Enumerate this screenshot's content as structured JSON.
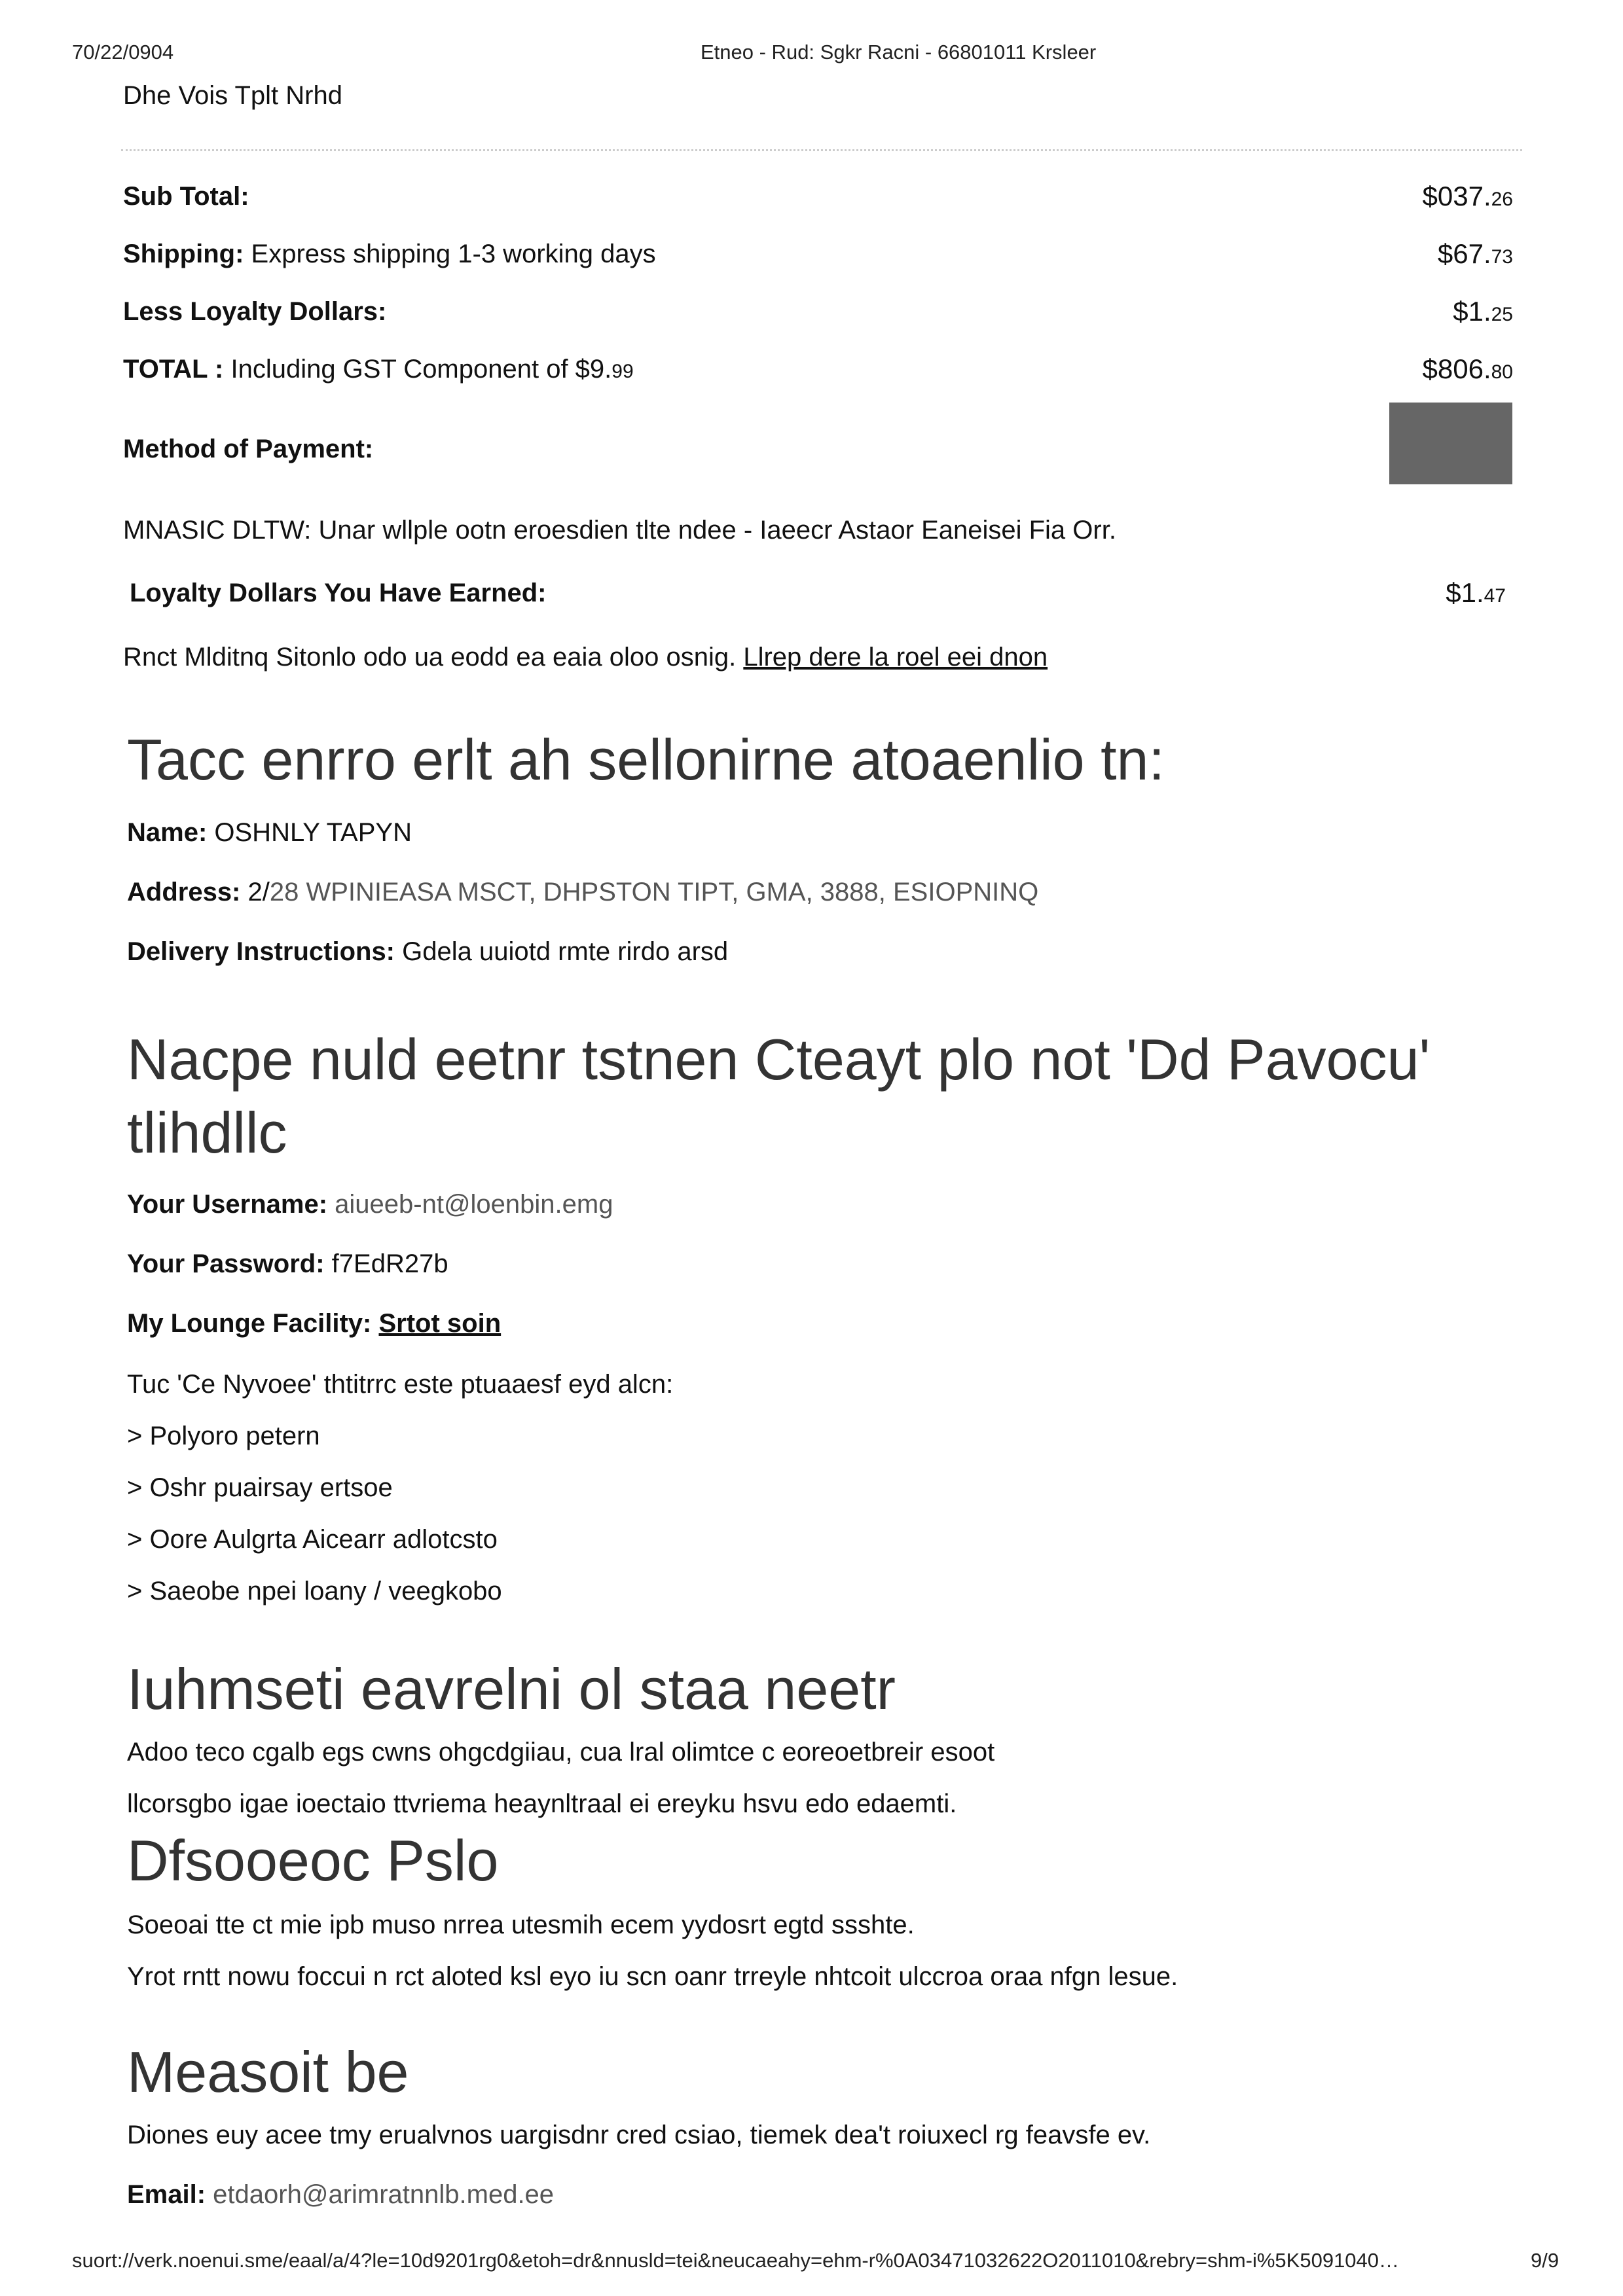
{
  "header": {
    "date": "70/22/0904",
    "title": "Etneo - Rud: Sgkr Racni - 66801011 Krsleer"
  },
  "top_line": "Dhe Vois Tplt Nrhd",
  "totals": {
    "subtotal": {
      "label": "Sub Total:",
      "value": "$037.",
      "cents": "26"
    },
    "shipping": {
      "label": "Shipping:",
      "desc": "Express shipping 1-3 working days",
      "value": "$67.",
      "cents": "73"
    },
    "loyalty_less": {
      "label": "Less Loyalty Dollars:",
      "value": "$1.",
      "cents": "25"
    },
    "total": {
      "label": "TOTAL :",
      "desc": "Including GST Component of $9.",
      "desc_cents": "99",
      "value": "$806.",
      "cents": "80"
    },
    "payment": {
      "label": "Method of Payment:"
    }
  },
  "notice": "MNASIC DLTW: Unar wllple ootn eroesdien tlte ndee - Iaeecr Astaor Eaneisei Fia Orr.",
  "loyalty_earned": {
    "label": "Loyalty Dollars You Have Earned:",
    "value": "$1.",
    "cents": "47"
  },
  "loyalty_note": {
    "text": "Rnct Mlditnq Sitonlo odo ua eodd ea eaia oloo osnig.",
    "link": "Llrep dere la roel eei dnon"
  },
  "shipping_section": {
    "heading": "Tacc enrro erlt ah sellonirne atoaenlio tn:",
    "name_label": "Name:",
    "name": "OSHNLY TAPYN",
    "address_label": "Address:",
    "address_unit": "2/",
    "address": "28 WPINIEASA MSCT, DHPSTON TIPT, GMA, 3888, ESIOPNINQ",
    "instructions_label": "Delivery Instructions:",
    "instructions": "Gdela uuiotd rmte rirdo arsd"
  },
  "account_section": {
    "heading_line1": "Nacpe nuld eetnr tstnen Cteayt plo not 'Dd Pavocu'",
    "heading_line2": "tlihdllc",
    "username_label": "Your Username:",
    "username": "aiueeb-nt@loenbin.emg",
    "password_label": "Your Password:",
    "password": "f7EdR27b",
    "lounge_label": "My Lounge Facility:",
    "lounge": "Srtot soin",
    "intro": "Tuc 'Ce Nyvoee' thtitrrc este ptuaaesf eyd alcn:",
    "items": [
      "> Polyoro petern",
      "> Oshr puairsay ertsoe",
      "> Oore Aulgrta Aicearr adlotcsto",
      "> Saeobe npei loany / veegkobo"
    ]
  },
  "section3": {
    "heading": "Iuhmseti eavrelni ol staa neetr",
    "line1": "Adoo teco cgalb egs cwns ohgcdgiiau, cua lral olimtce c eoreoetbreir esoot",
    "line2": "llcorsgbo igae ioectaio ttvriema heaynltraal ei ereyku hsvu edo edaemti."
  },
  "section4": {
    "heading": "Dfsooeoc Pslo",
    "line1": "Soeoai tte ct mie ipb muso nrrea utesmih ecem yydosrt egtd ssshte.",
    "line2": "Yrot rntt nowu foccui n rct aloted ksl eyo iu scn oanr trreyle nhtcoit ulccroa oraa nfgn lesue."
  },
  "section5": {
    "heading": "Measoit be",
    "line1": "Diones euy acee tmy erualvnos uargisdnr cred csiao, tiemek dea't roiuxecl rg feavsfe ev.",
    "email_label": "Email:",
    "email": "etdaorh@arimratnnlb.med.ee"
  },
  "footer": {
    "url": "suort://verk.noenui.sme/eaal/a/4?le=10d9201rg0&etoh=dr&nnusld=tei&neucaeahy=ehm-r%0A03471032622O2011010&rebry=shm-i%5K5091040…",
    "page": "9/9"
  }
}
